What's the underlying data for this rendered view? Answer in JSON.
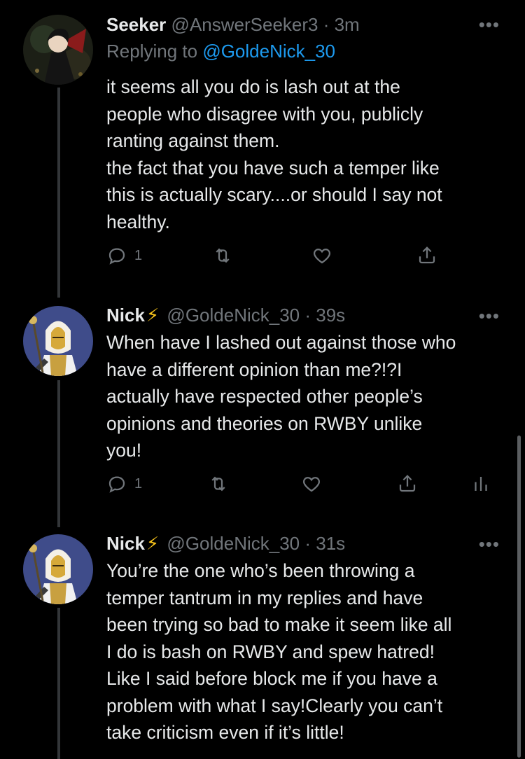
{
  "colors": {
    "background": "#000000",
    "text": "#e7e9ea",
    "muted": "#71767b",
    "link": "#1d9bf0",
    "bolt": "#f7c31b"
  },
  "tweets": [
    {
      "display_name": "Seeker",
      "handle": "@AnswerSeeker3",
      "time": "· 3m",
      "replying_prefix": "Replying to",
      "replying_to": "@GoldeNick_30",
      "text": "it seems all you do is lash out at the\npeople who disagree  with you, publicly\nranting against them.\nthe fact that you have such a temper like\nthis is actually scary....or should I say not\nhealthy.",
      "reply_count": "1",
      "icons": [
        "reply-icon",
        "retweet-icon",
        "like-icon",
        "share-icon"
      ]
    },
    {
      "display_name": "Nick",
      "badge": "⚡",
      "handle": "@GoldeNick_30",
      "time": "· 39s",
      "text": "When have I lashed out against those who\nhave a different opinion than me?!?I\nactually have respected other people’s\nopinions and theories on RWBY unlike\nyou!",
      "reply_count": "1",
      "icons": [
        "reply-icon",
        "retweet-icon",
        "like-icon",
        "share-icon",
        "analytics-icon"
      ]
    },
    {
      "display_name": "Nick",
      "badge": "⚡",
      "handle": "@GoldeNick_30",
      "time": "· 31s",
      "text": "You’re the one who’s been throwing a\ntemper tantrum in my replies and have\nbeen trying so bad to make it seem like all\nI do is bash on RWBY and spew hatred!\nLike I said before block me if you have a\nproblem with what I say!Clearly you can’t\ntake criticism even if it’s little!"
    }
  ]
}
